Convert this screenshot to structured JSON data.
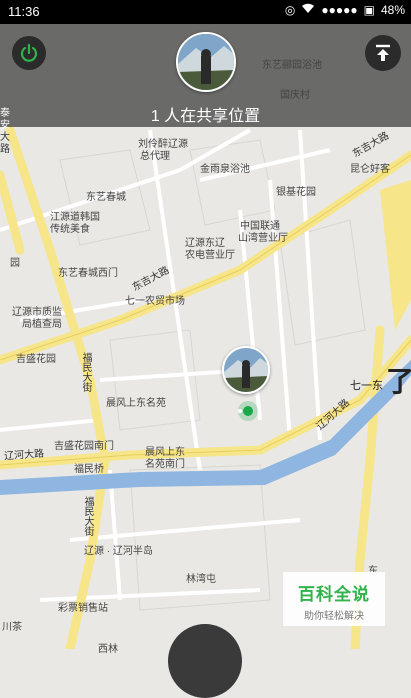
{
  "status_bar": {
    "time": "11:36",
    "battery": "48%",
    "signal_dots": "●●●●●"
  },
  "header": {
    "share_text": "1 人在共享位置"
  },
  "map_labels": {
    "dongyi_yuanyuan_chi": "东艺郦园浴池",
    "guoqing_cun": "国庆村",
    "liuling_zui": "刘伶醉辽源",
    "zongdai_li": "总代理",
    "jinyu_quan": "金雨泉浴池",
    "dongji_dalu_top": "东吉大路",
    "kunlun_haoke": "昆仑好客",
    "yinji_huayuan": "银基花园",
    "dongyi_chuncheng": "东艺春城",
    "liaoyuan_hanguo": "江源道韩国",
    "chuantong_meishi": "传统美食",
    "zhongguo_liantong": "中国联通",
    "shanwan_yingye": "山湾营业厅",
    "liaoyuan_dongliao": "辽源东辽",
    "nongdian_yingye": "农电营业厅",
    "yuan": "园",
    "dongyi_xihmen": "东艺春城西门",
    "dongji_dalu_mid": "东吉大路",
    "qiyi_shichang": "七一农贸市场",
    "zhijian_ju1": "辽源市质监",
    "zhijian_ju2": "局植查局",
    "jisheng_huayuan": "吉盛花园",
    "fumin_dajie_top": "福民大街",
    "chenfeng_mingyuan": "晨风上东名苑",
    "qiyi_partial": "七一东",
    "liaohe_dalu_right": "辽河大路",
    "liaohe_dalu_left": "辽河大路",
    "jisheng_nanmen": "吉盛花园南门",
    "chenfeng_nanmen1": "晨风上东",
    "chenfeng_nanmen2": "名苑南门",
    "fumin_qiao": "福民桥",
    "fumin_dajie_bottom": "福民大街",
    "liaoyuan_bandao": "辽源 · 辽河半岛",
    "linwan_tun": "林湾屯",
    "caipiao": "彩票销售站",
    "chuan_cha": "川茶",
    "dong_partial": "东",
    "xilin_partial": "西林",
    "liao_big": "了",
    "tai_an1": "泰",
    "tai_an2": "安",
    "tai_an3": "大",
    "tai_an4": "路"
  },
  "watermark": {
    "title": "百科全说",
    "subtitle": "助你轻松解决"
  },
  "colors": {
    "road": "#f7e58a",
    "river": "#8fb6e0",
    "marker": "#1aa84a",
    "overlay": "#464646"
  }
}
